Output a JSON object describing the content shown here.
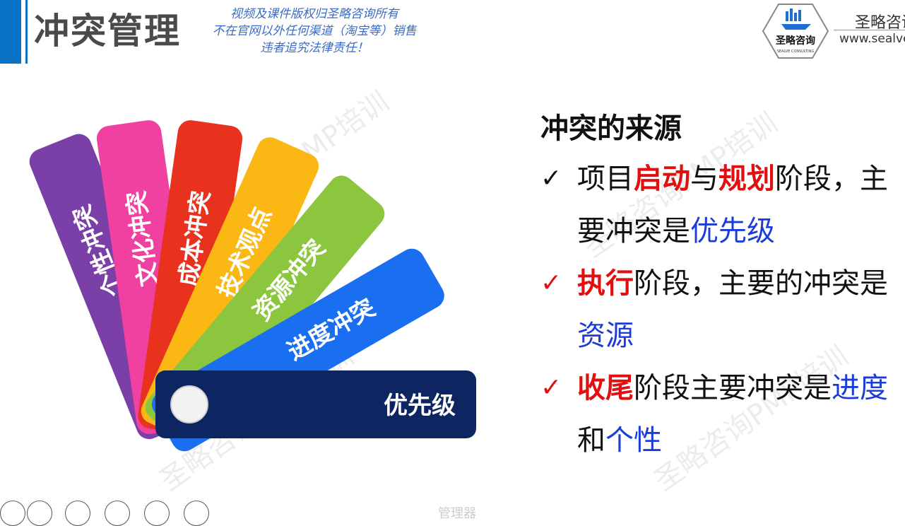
{
  "header": {
    "title": "冲突管理",
    "copyright_lines": [
      "视频及课件版权归圣略咨询所有",
      "不在官网以外任何渠道（淘宝等）销售",
      "违者追究法律责任！"
    ],
    "logo_text": "圣略咨询",
    "logo_sub": "SEALVE CONSULTING",
    "brand_name": "圣略咨询",
    "brand_url": "www.sealve.com"
  },
  "fan": {
    "cards": [
      {
        "label": "个性冲突",
        "color": "#7b3fa8"
      },
      {
        "label": "文化冲突",
        "color": "#f040a0"
      },
      {
        "label": "成本冲突",
        "color": "#e8321e"
      },
      {
        "label": "技术观点",
        "color": "#fbb814"
      },
      {
        "label": "资源冲突",
        "color": "#8cc63e"
      },
      {
        "label": "进度冲突",
        "color": "#1a6ff0"
      },
      {
        "label": "优先级",
        "color": "#0d2560"
      }
    ]
  },
  "sources": {
    "title": "冲突的来源",
    "items": [
      {
        "check_icon": "check-icon",
        "parts": [
          [
            "项目",
            ""
          ],
          [
            "启动",
            "red"
          ],
          [
            "与",
            ""
          ],
          [
            "规划",
            "red"
          ],
          [
            "阶段，",
            ""
          ],
          [
            "主要冲突是",
            ""
          ],
          [
            "优先级",
            "blue"
          ]
        ]
      },
      {
        "check_icon": "check-icon",
        "parts": [
          [
            "执行",
            "red"
          ],
          [
            "阶段，主要的冲突是",
            ""
          ],
          [
            "资源",
            "blue"
          ]
        ]
      },
      {
        "check_icon": "check-icon",
        "parts": [
          [
            "收尾",
            "red"
          ],
          [
            "阶段主要冲突是",
            ""
          ],
          [
            "进度",
            "blue"
          ],
          [
            "和",
            ""
          ],
          [
            "个性",
            "blue"
          ]
        ]
      }
    ]
  },
  "watermark": "圣略咨询PMP培训",
  "footer": {
    "note": "管理器"
  }
}
